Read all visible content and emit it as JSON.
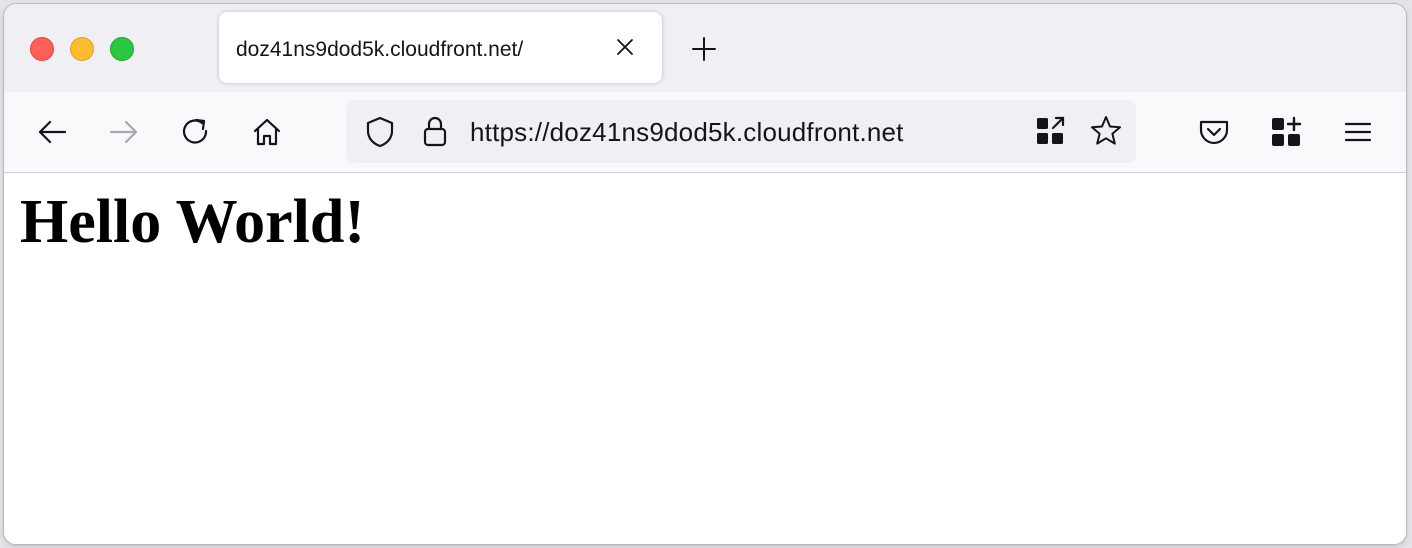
{
  "window": {
    "controls": [
      "close",
      "minimize",
      "maximize"
    ],
    "colors": {
      "close": "#ff5f57",
      "minimize": "#febc2e",
      "maximize": "#28c840"
    }
  },
  "tabs": [
    {
      "title": "doz41ns9dod5k.cloudfront.net/",
      "active": true,
      "close_icon": "close-icon"
    }
  ],
  "toolbar": {
    "back_icon": "arrow-left-icon",
    "forward_icon": "arrow-right-icon",
    "forward_enabled": false,
    "reload_icon": "reload-icon",
    "home_icon": "home-icon",
    "new_tab_icon": "plus-icon"
  },
  "urlbar": {
    "url": "https://doz41ns9dod5k.cloudfront.net",
    "icons": [
      "shield-icon",
      "lock-icon",
      "qr-code-icon",
      "star-icon"
    ]
  },
  "right_toolbar": {
    "icons": [
      "pocket-icon",
      "extensions-icon",
      "menu-icon"
    ]
  },
  "page": {
    "heading": "Hello World!"
  }
}
